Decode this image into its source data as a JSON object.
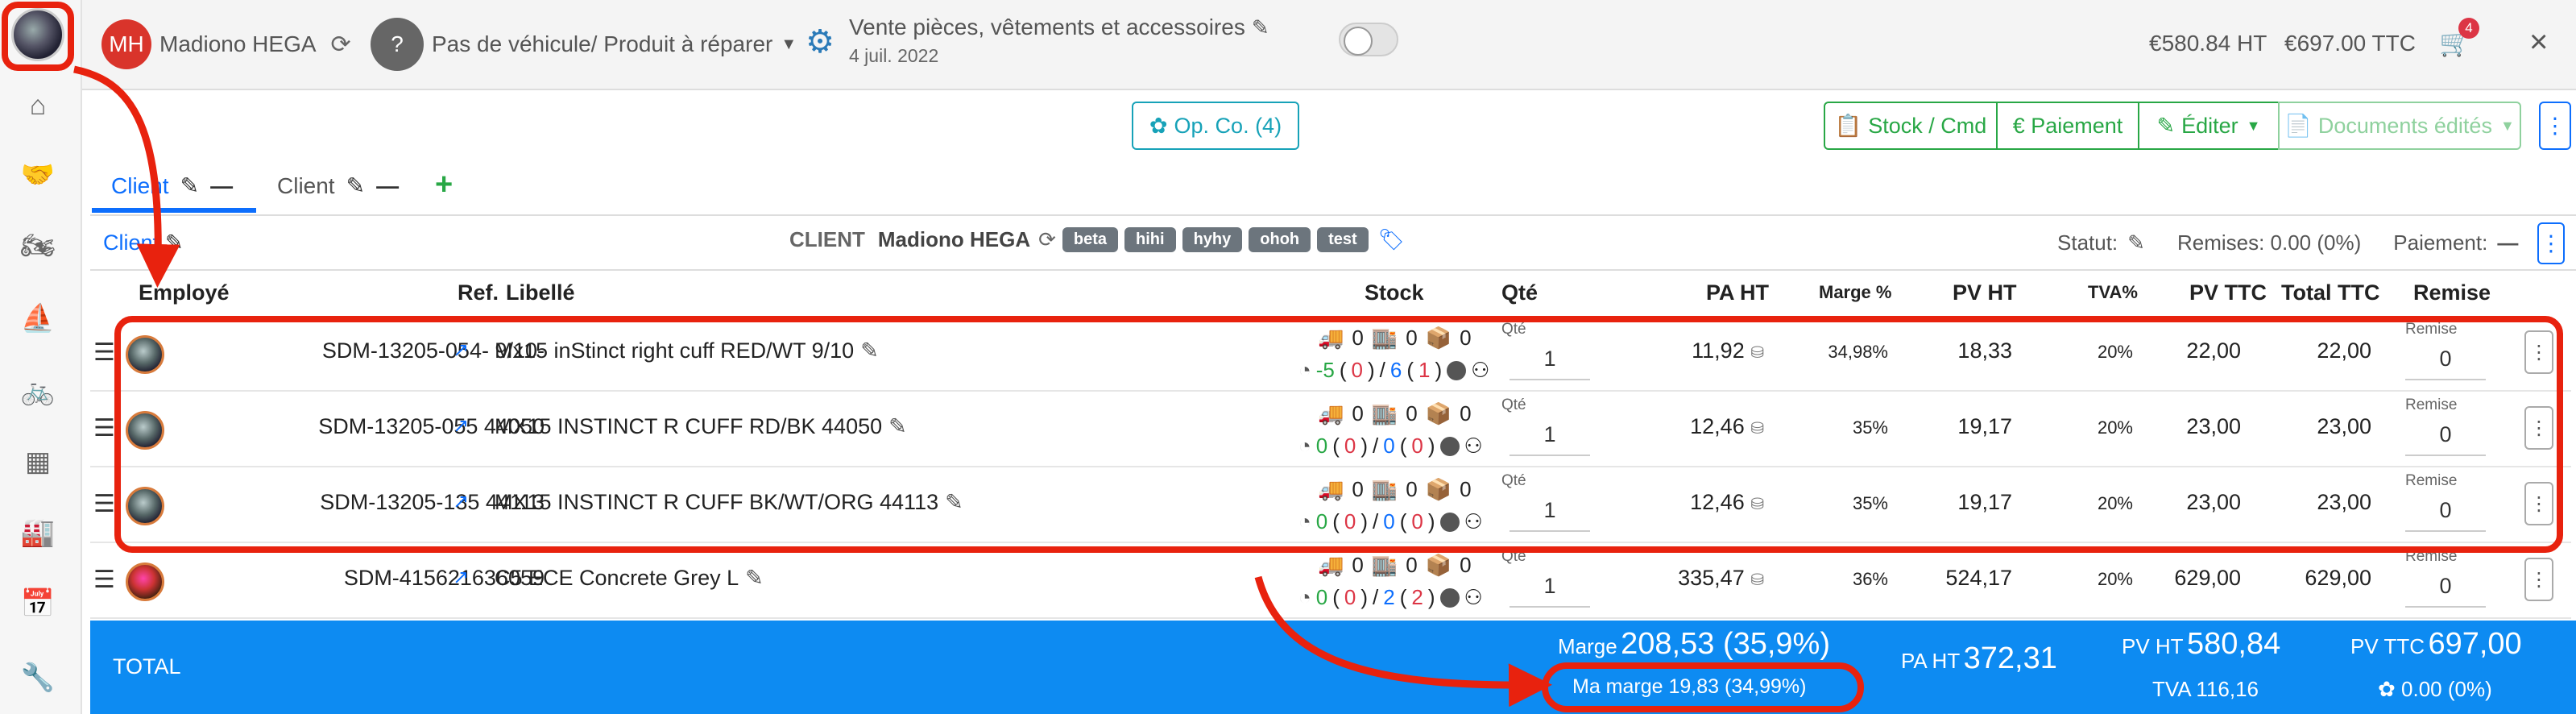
{
  "topbar": {
    "user_initials": "MH",
    "user_name": "Madiono HEGA",
    "vehicle_icon_text": "?",
    "vehicle": "Pas de véhicule/ Produit à réparer",
    "sale_type": "Vente pièces, vêtements et accessoires",
    "date": "4 juil. 2022",
    "total_ht": "€580.84 HT",
    "total_ttc": "€697.00 TTC",
    "cart_count": "4",
    "close_label": "×"
  },
  "toolbar": {
    "op_co_label": "Op. Co. (4)",
    "stock_cmd_label": "Stock / Cmd",
    "paiement_label": "€ Paiement",
    "editer_label": "Éditer",
    "documents_label": "Documents édités",
    "more_label": "⋮"
  },
  "tabs": [
    {
      "label": "Client",
      "active": true
    },
    {
      "label": "Client",
      "active": false
    }
  ],
  "client_bar": {
    "link_label": "Client",
    "client_title": "CLIENT",
    "client_name": "Madiono HEGA",
    "tags": [
      "beta",
      "hihi",
      "hyhy",
      "ohoh",
      "test"
    ],
    "statut_label": "Statut:",
    "remises_label": "Remises: 0.00 (0%)",
    "paiement_label": "Paiement:",
    "paiement_value": "—"
  },
  "table": {
    "headers": {
      "employe": "Employé",
      "ref": "Ref.",
      "libelle": "Libellé",
      "stock": "Stock",
      "qte": "Qté",
      "pa_ht": "PA HT",
      "marge": "Marge %",
      "pv_ht": "PV HT",
      "tva": "TVA%",
      "pv_ttc": "PV TTC",
      "total_ttc": "Total TTC",
      "remise": "Remise"
    },
    "qty_label": "Qté",
    "remise_label": "Remise",
    "rows": [
      {
        "ref": "SDM-13205-054- 9/10-",
        "libelle": "Mx15 inStinct right cuff RED/WT 9/10",
        "s_truck": "0",
        "s_store": "0",
        "s_box": "0",
        "s_avail": "-5",
        "s_res": "0",
        "s_ord": "6",
        "s_back": "1",
        "qty": "1",
        "pa_ht": "11,92",
        "marge": "34,98%",
        "pv_ht": "18,33",
        "tva": "20%",
        "pv_ttc": "22,00",
        "total_ttc": "22,00",
        "remise": "0"
      },
      {
        "ref": "SDM-13205-055 44050",
        "libelle": "MX15 INSTINCT R CUFF RD/BK 44050",
        "s_truck": "0",
        "s_store": "0",
        "s_box": "0",
        "s_avail": "0",
        "s_res": "0",
        "s_ord": "0",
        "s_back": "0",
        "qty": "1",
        "pa_ht": "12,46",
        "marge": "35%",
        "pv_ht": "19,17",
        "tva": "20%",
        "pv_ttc": "23,00",
        "total_ttc": "23,00",
        "remise": "0"
      },
      {
        "ref": "SDM-13205-135 44113",
        "libelle": "MX15 INSTINCT R CUFF BK/WT/ORG 44113",
        "s_truck": "0",
        "s_store": "0",
        "s_box": "0",
        "s_avail": "0",
        "s_res": "0",
        "s_ord": "0",
        "s_back": "0",
        "qty": "1",
        "pa_ht": "12,46",
        "marge": "35%",
        "pv_ht": "19,17",
        "tva": "20%",
        "pv_ttc": "23,00",
        "total_ttc": "23,00",
        "remise": "0"
      },
      {
        "ref": "SDM-415621636059",
        "libelle": "C5 ECE Concrete Grey L",
        "s_truck": "0",
        "s_store": "0",
        "s_box": "0",
        "s_avail": "0",
        "s_res": "0",
        "s_ord": "2",
        "s_back": "2",
        "qty": "1",
        "pa_ht": "335,47",
        "marge": "36%",
        "pv_ht": "524,17",
        "tva": "20%",
        "pv_ttc": "629,00",
        "total_ttc": "629,00",
        "remise": "0"
      }
    ]
  },
  "total": {
    "label": "TOTAL",
    "marge_label": "Marge",
    "marge_value": "208,53 (35,9%)",
    "ma_marge": "Ma marge 19,83 (34,99%)",
    "pa_ht_label": "PA HT",
    "pa_ht_value": "372,31",
    "pv_ht_label": "PV HT",
    "pv_ht_value": "580,84",
    "tva": "TVA 116,16",
    "pv_ttc_label": "PV TTC",
    "pv_ttc_value": "697,00",
    "remise": "0.00 (0%)"
  },
  "colors": {
    "accent": "#0d6efd",
    "total_bar": "#0d8bf2",
    "annotation": "#e8220e",
    "success": "#28a745"
  }
}
